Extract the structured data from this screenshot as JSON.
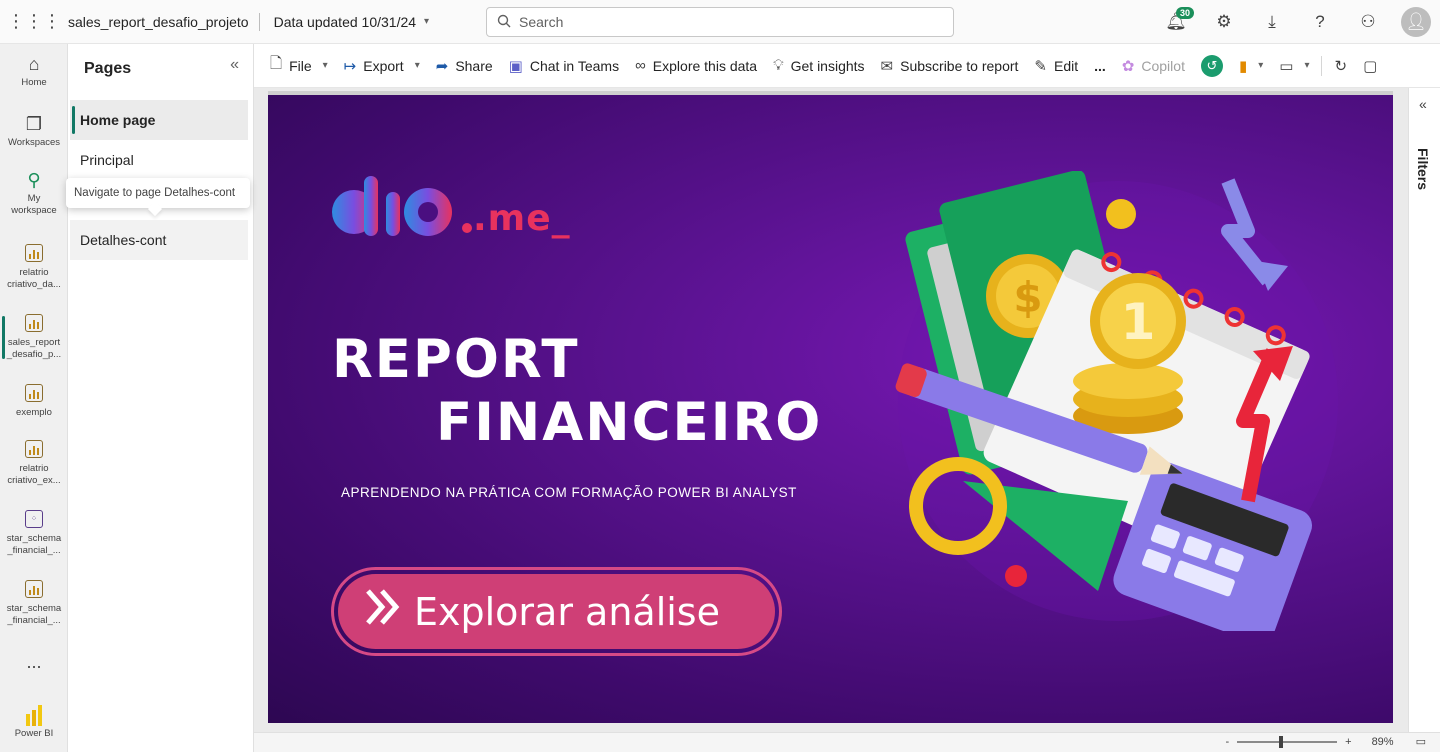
{
  "topbar": {
    "report_title": "sales_report_desafio_projeto",
    "data_updated": "Data updated 10/31/24",
    "search_placeholder": "Search",
    "notification_count": "30"
  },
  "leftnav": {
    "items": [
      {
        "label": "Home",
        "icon": "home-icon"
      },
      {
        "label": "Workspaces",
        "icon": "workspaces-icon"
      },
      {
        "label": "My workspace",
        "icon": "person-icon"
      },
      {
        "label": "relatrio criativo_da...",
        "icon": "report-icon"
      },
      {
        "label": "sales_report _desafio_p...",
        "icon": "report-icon"
      },
      {
        "label": "exemplo",
        "icon": "report-icon"
      },
      {
        "label": "relatrio criativo_ex...",
        "icon": "report-icon"
      },
      {
        "label": "star_schema _financial_...",
        "icon": "semantic-model-icon"
      },
      {
        "label": "star_schema _financial_...",
        "icon": "report-icon"
      }
    ],
    "more": "...",
    "brand": "Power BI"
  },
  "pages": {
    "title": "Pages",
    "items": [
      "Home page",
      "Principal",
      "Detalhes-cont"
    ],
    "tooltip": "Navigate to page Detalhes-cont"
  },
  "toolbar": {
    "file": "File",
    "export": "Export",
    "share": "Share",
    "chat": "Chat in Teams",
    "explore": "Explore this data",
    "insights": "Get insights",
    "subscribe": "Subscribe to report",
    "edit": "Edit",
    "more": "...",
    "copilot": "Copilot"
  },
  "report": {
    "logo_suffix": ".me_",
    "title_line1": "REPORT",
    "title_line2": "FINANCEIRO",
    "subtitle": "APRENDENDO NA PRÁTICA  COM FORMAÇÃO POWER BI ANALYST",
    "cta": "Explorar análise",
    "colors": {
      "background": "#5d1394",
      "accent_pink": "#cf3f76",
      "logo_red": "#e8325e"
    }
  },
  "filters_panel": {
    "label": "Filters"
  },
  "status": {
    "zoom": "89%",
    "minus": "-",
    "plus": "+"
  }
}
